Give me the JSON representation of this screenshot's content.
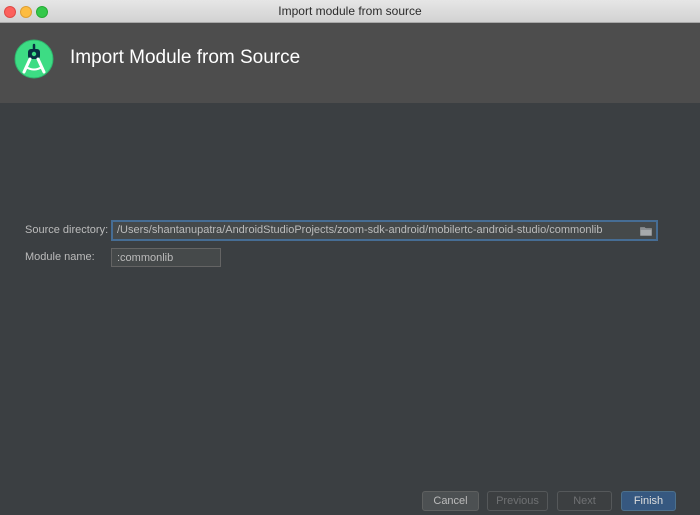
{
  "window": {
    "title": "Import module from source"
  },
  "header": {
    "title": "Import Module from Source",
    "logo_icon": "android-studio-icon"
  },
  "form": {
    "source_directory": {
      "label": "Source directory:",
      "value": "/Users/shantanupatra/AndroidStudioProjects/zoom-sdk-android/mobilertc-android-studio/commonlib",
      "browse_icon": "folder-icon"
    },
    "module_name": {
      "label": "Module name:",
      "value": ":commonlib"
    }
  },
  "footer": {
    "cancel_label": "Cancel",
    "previous_label": "Previous",
    "next_label": "Next",
    "finish_label": "Finish"
  },
  "colors": {
    "background": "#3b3f42",
    "header": "#4d4d4d",
    "accent": "#365880",
    "focus": "#466d94"
  }
}
